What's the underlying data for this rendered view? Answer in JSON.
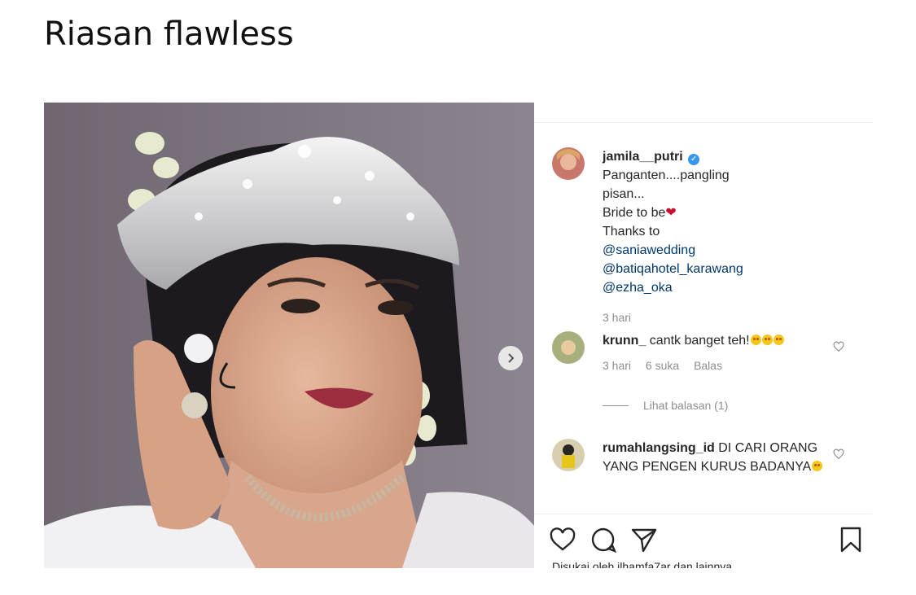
{
  "article": {
    "title": "Riasan flawless"
  },
  "post": {
    "caption": {
      "username": "jamila__putri",
      "lines": [
        "Panganten....pangling",
        "pisan...",
        "Bride to be",
        "Thanks to"
      ],
      "mentions": [
        "@saniawedding",
        "@batiqahotel_karawang",
        "@ezha_oka"
      ],
      "time": "3 hari"
    },
    "comments": [
      {
        "username": "krunn_",
        "text": "cantk banget teh!",
        "time": "3 hari",
        "likes": "6 suka",
        "reply_label": "Balas",
        "view_replies": "Lihat balasan (1)"
      },
      {
        "username": "rumahlangsing_id",
        "text": "DI CARI ORANG YANG PENGEN KURUS BADANYA"
      }
    ],
    "liked_by": "Disukai oleh ilhamfa7ar dan lainnya"
  },
  "colors": {
    "mention": "#00376b",
    "muted": "#8e8e8e",
    "verified": "#3897f0",
    "heart": "#c8102e"
  },
  "icons": [
    "verified-badge-icon",
    "red-heart-icon",
    "smiley-emoji-icon",
    "heart-outline-icon",
    "comment-icon",
    "share-icon",
    "bookmark-icon",
    "chevron-right-icon"
  ]
}
